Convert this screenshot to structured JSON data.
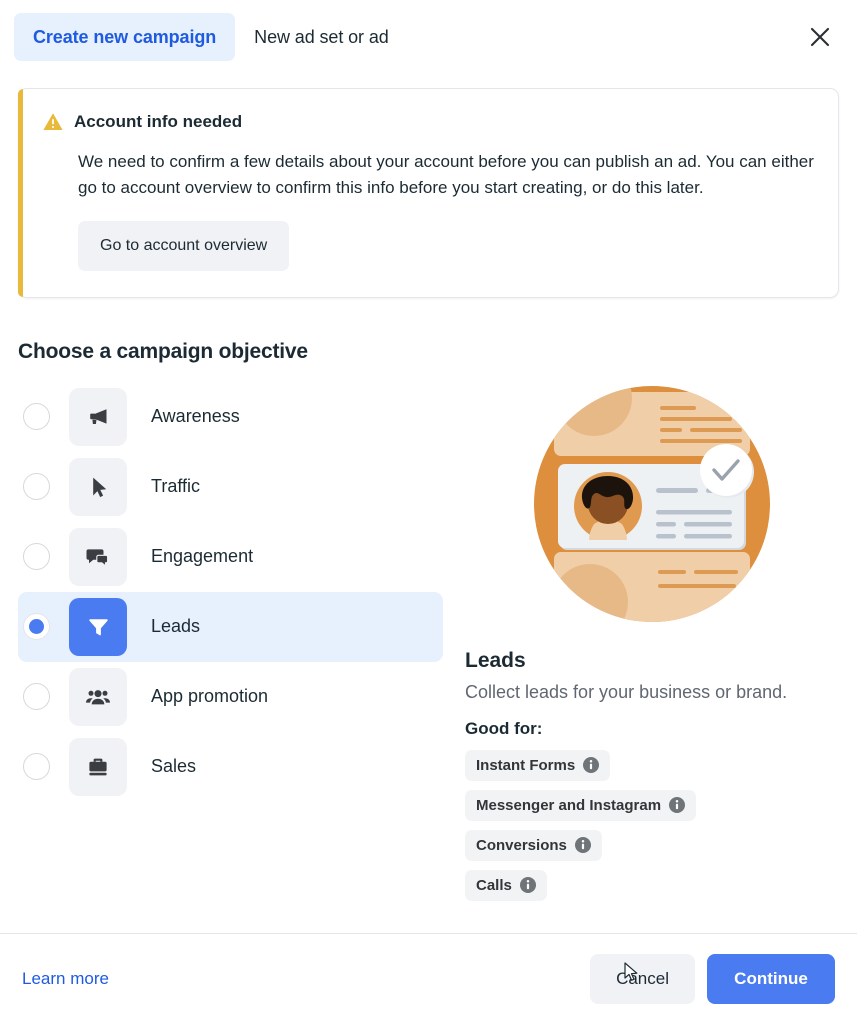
{
  "header": {
    "tab_active": "Create new campaign",
    "tab_inactive": "New ad set or ad",
    "close_icon": "close-icon"
  },
  "alert": {
    "icon": "warning-triangle-icon",
    "title": "Account info needed",
    "body": "We need to confirm a few details about your account before you can publish an ad. You can either go to account overview to confirm this info before you start creating, or do this later.",
    "button_label": "Go to account overview",
    "accent_color": "#e9b93c"
  },
  "objectives": {
    "section_title": "Choose a campaign objective",
    "selected": "Leads",
    "items": [
      {
        "label": "Awareness",
        "icon": "megaphone-icon",
        "selected": false
      },
      {
        "label": "Traffic",
        "icon": "cursor-arrow-icon",
        "selected": false
      },
      {
        "label": "Engagement",
        "icon": "chat-bubbles-icon",
        "selected": false
      },
      {
        "label": "Leads",
        "icon": "funnel-icon",
        "selected": true
      },
      {
        "label": "App promotion",
        "icon": "people-group-icon",
        "selected": false
      },
      {
        "label": "Sales",
        "icon": "briefcase-icon",
        "selected": false
      }
    ]
  },
  "detail": {
    "illustration": "lead-card-illustration",
    "title": "Leads",
    "description": "Collect leads for your business or brand.",
    "good_for_label": "Good for:",
    "chips": [
      {
        "label": "Instant Forms",
        "icon": "info-icon"
      },
      {
        "label": "Messenger and Instagram",
        "icon": "info-icon"
      },
      {
        "label": "Conversions",
        "icon": "info-icon"
      },
      {
        "label": "Calls",
        "icon": "info-icon"
      }
    ]
  },
  "footer": {
    "learn_more": "Learn more",
    "cancel": "Cancel",
    "continue": "Continue",
    "primary_color": "#4a7bf0"
  }
}
